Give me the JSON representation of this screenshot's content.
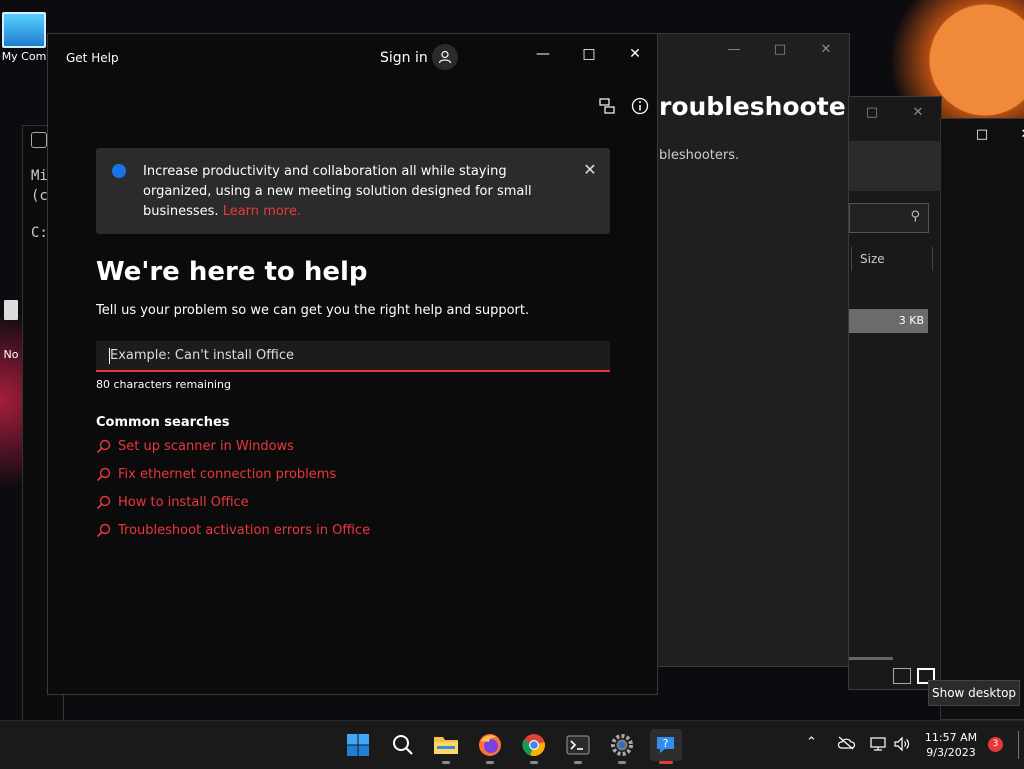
{
  "desktop": {
    "icons": [
      {
        "label": "My Com"
      },
      {
        "label": "No"
      }
    ]
  },
  "terminal_window": {
    "lines": [
      "Mi",
      "(c",
      "C:"
    ]
  },
  "troubleshooter_window": {
    "title": "roubleshoote",
    "subtitle": "bleshooters."
  },
  "explorer_window": {
    "column_header": "Size",
    "file_size": "3 KB"
  },
  "get_help": {
    "title": "Get Help",
    "sign_in": "Sign in",
    "banner": {
      "text": "Increase productivity and collaboration all while staying organized, using a new meeting solution designed for small businesses.",
      "link": "Learn more."
    },
    "heading": "We're here to help",
    "subtext": "Tell us your problem so we can get you the right help and support.",
    "search": {
      "placeholder": "Example: Can't install Office",
      "value": ""
    },
    "remaining": "80 characters remaining",
    "common_searches_title": "Common searches",
    "common_searches": [
      "Set up scanner in Windows",
      "Fix ethernet connection problems",
      "How to install Office",
      "Troubleshoot activation errors in Office"
    ]
  },
  "taskbar": {
    "apps": [
      "start-icon",
      "search-icon",
      "file-explorer-icon",
      "firefox-icon",
      "chrome-icon",
      "terminal-icon",
      "settings-icon",
      "get-help-icon"
    ],
    "clock_time": "11:57 AM",
    "clock_date": "9/3/2023",
    "notification_count": "3",
    "tooltip": "Show desktop"
  },
  "colors": {
    "accent": "#e8383d",
    "info": "#1a73e8",
    "window_bg": "#0b0b0b",
    "taskbar_bg": "#1a1a1a"
  }
}
